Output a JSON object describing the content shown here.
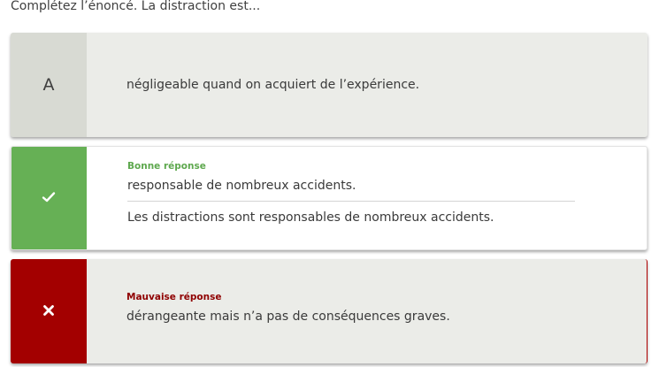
{
  "question": "Complétez l’énoncé. La distraction est...",
  "options": [
    {
      "marker": "A",
      "text": "négligeable quand on acquiert de l’expérience."
    },
    {
      "marker_icon": "check-icon",
      "status": "Bonne réponse",
      "text": "responsable de nombreux accidents.",
      "explanation": "Les distractions sont responsables de nombreux accidents."
    },
    {
      "marker_icon": "cross-icon",
      "status": "Mauvaise réponse",
      "text": "dérangeante mais n’a pas de conséquences graves."
    }
  ],
  "colors": {
    "correct": "#66b055",
    "wrong": "#a30000",
    "neutral": "#d8dad3",
    "card_bg": "#ebece8"
  }
}
